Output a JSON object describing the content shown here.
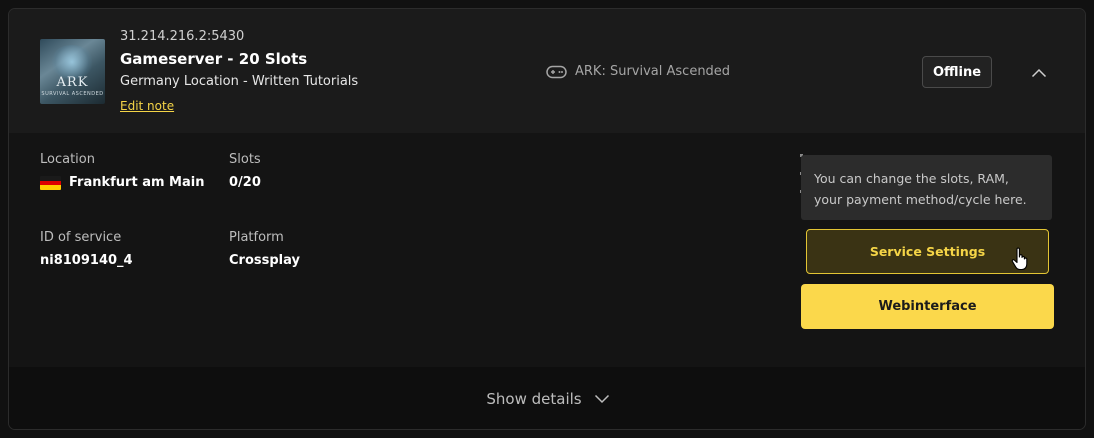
{
  "server": {
    "ip": "31.214.216.2:5430",
    "name": "Gameserver - 20 Slots",
    "description": "Germany Location - Written Tutorials",
    "edit_note": "Edit note",
    "thumbnail_text": "ARK",
    "thumbnail_subtext": "SURVIVAL ASCENDED"
  },
  "game": {
    "icon": "gamepad-icon",
    "name": "ARK: Survival Ascended"
  },
  "status": {
    "label": "Offline"
  },
  "collapse_icon": "chevron-up-icon",
  "details": {
    "location_label": "Location",
    "location_flag": "germany-flag-icon",
    "location_value": "Frankfurt am Main",
    "slots_label": "Slots",
    "slots_value": "0/20",
    "id_label": "ID of service",
    "id_value": "ni8109140_4",
    "platform_label": "Platform",
    "platform_value": "Crossplay"
  },
  "tooltip": {
    "text": "You can change the slots, RAM, your payment method/cycle here."
  },
  "buttons": {
    "service_settings": "Service Settings",
    "webinterface": "Webinterface"
  },
  "footer": {
    "show_details": "Show details",
    "icon": "chevron-down-icon"
  },
  "colors": {
    "accent": "#fbd84b",
    "card_bg": "#141414",
    "header_bg": "#1b1b1b",
    "tooltip_bg": "#2c2c2c"
  }
}
